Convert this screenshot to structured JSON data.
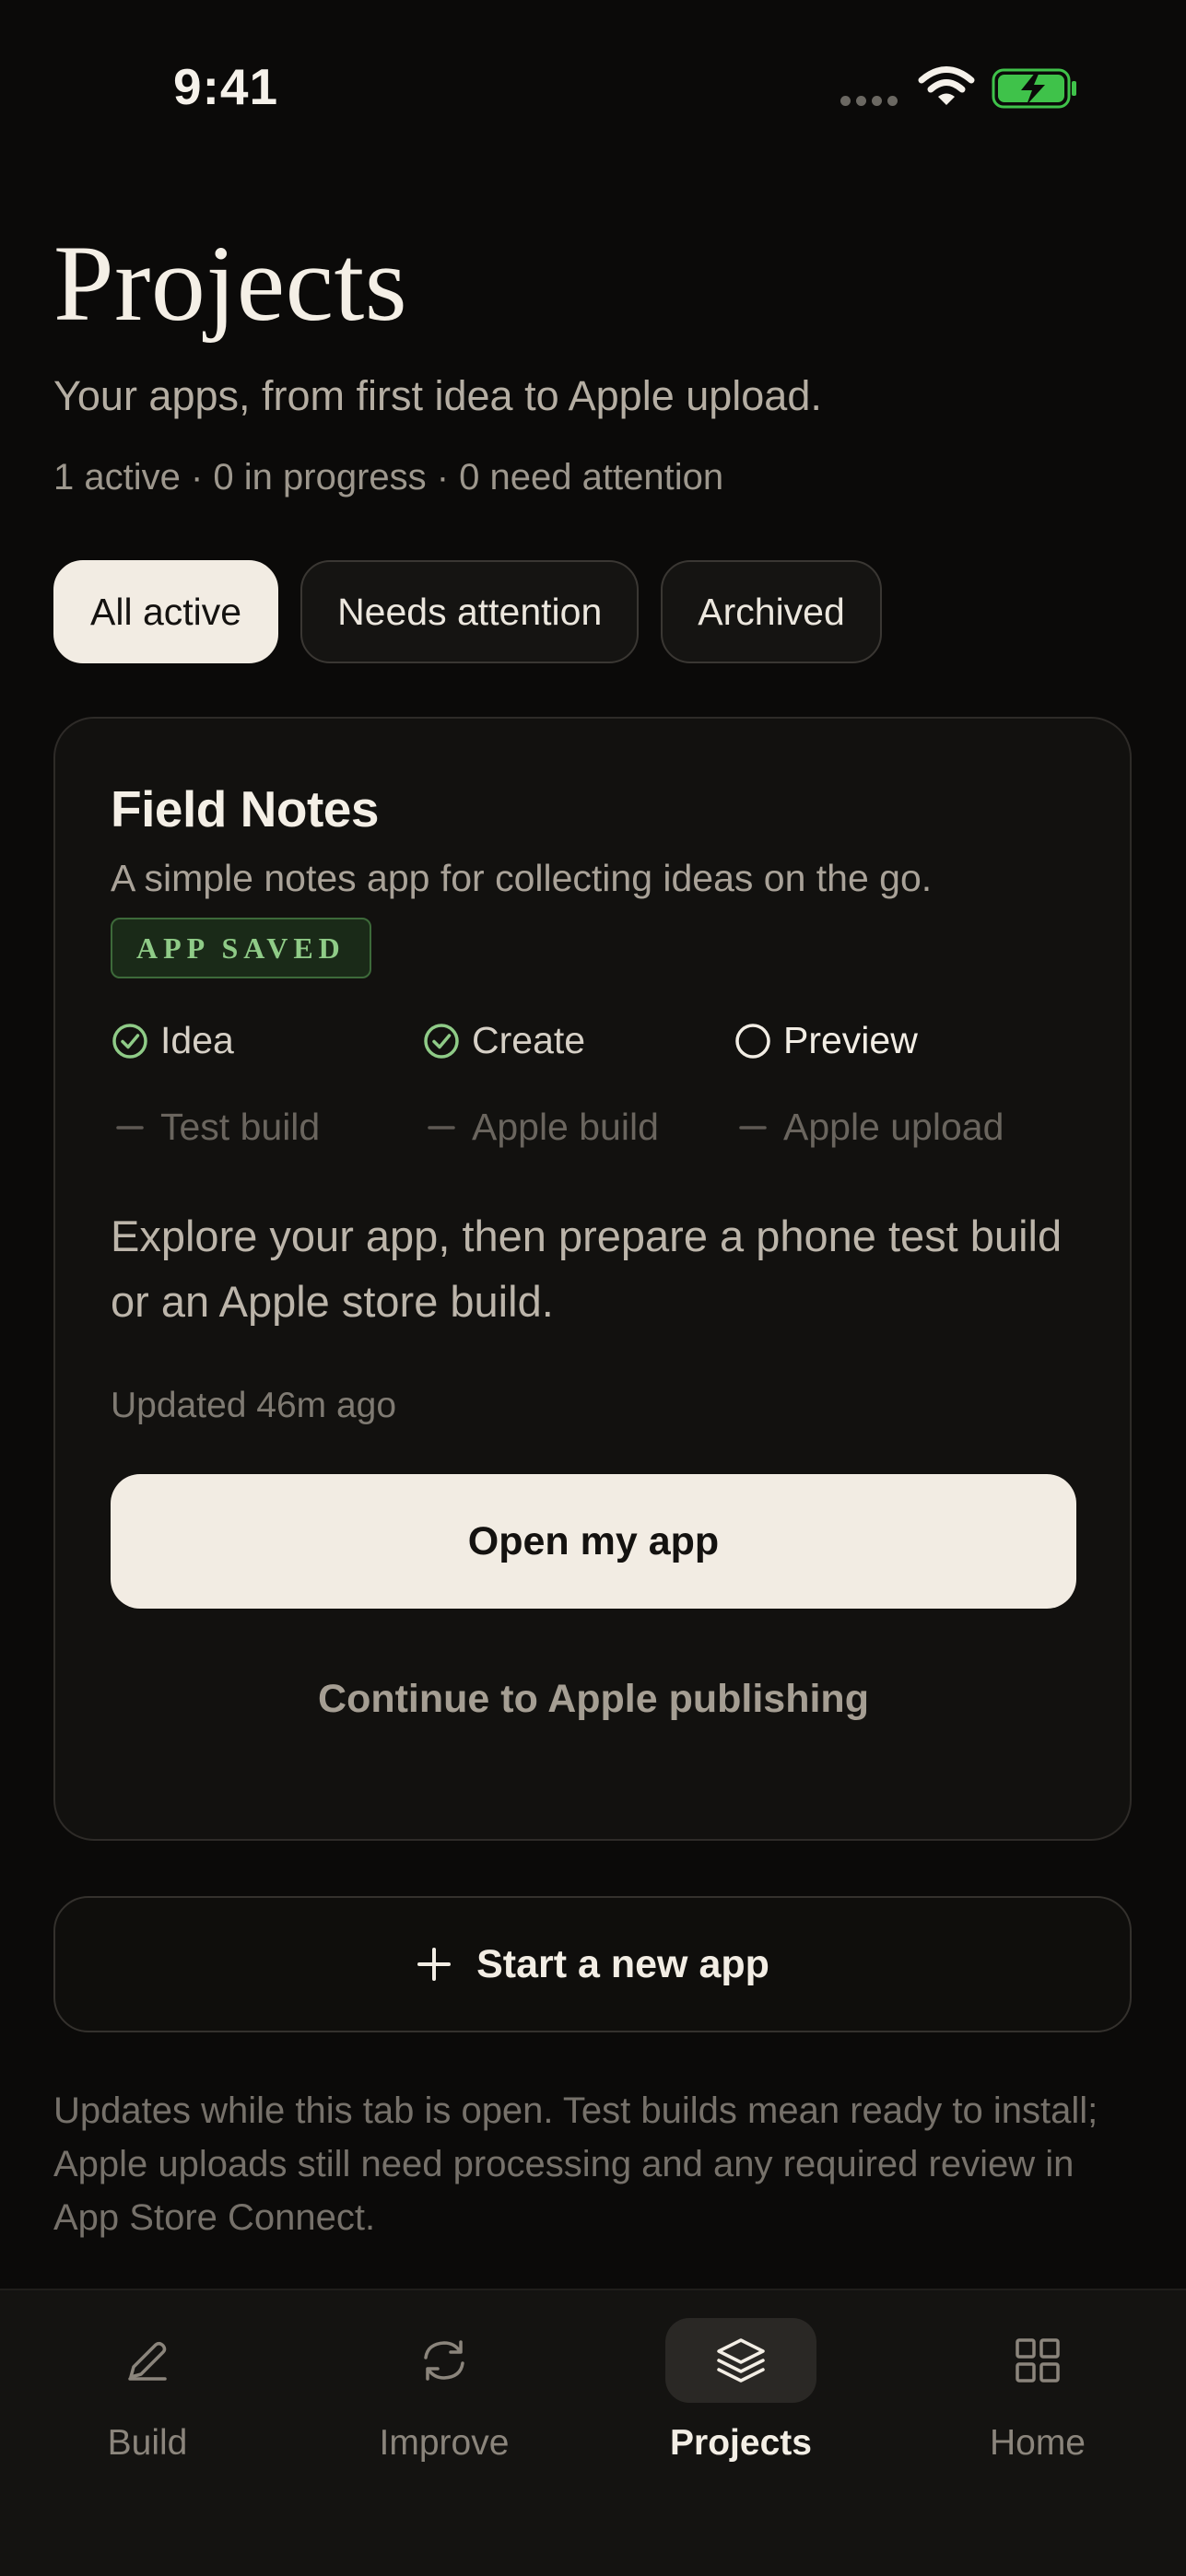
{
  "status_bar": {
    "time": "9:41"
  },
  "header": {
    "title": "Projects",
    "subtitle": "Your apps, from first idea to Apple upload.",
    "counts": "1 active · 0 in progress · 0 need attention"
  },
  "filters": [
    {
      "label": "All active",
      "active": true
    },
    {
      "label": "Needs attention",
      "active": false
    },
    {
      "label": "Archived",
      "active": false
    }
  ],
  "project": {
    "title": "Field Notes",
    "description": "A simple notes app for collecting ideas on the go.",
    "badge": "APP SAVED",
    "steps": [
      {
        "label": "Idea",
        "state": "done"
      },
      {
        "label": "Create",
        "state": "done"
      },
      {
        "label": "Preview",
        "state": "current"
      },
      {
        "label": "Test build",
        "state": "pending"
      },
      {
        "label": "Apple build",
        "state": "pending"
      },
      {
        "label": "Apple upload",
        "state": "pending"
      }
    ],
    "note": "Explore your app, then prepare a phone test build or an Apple store build.",
    "updated": "Updated 46m ago",
    "primary_action": "Open my app",
    "secondary_action": "Continue to Apple publishing"
  },
  "new_app_label": "Start a new app",
  "footnote": "Updates while this tab is open. Test builds mean ready to install; Apple uploads still need processing and any required review in App Store Connect.",
  "tabs": [
    {
      "label": "Build",
      "icon": "pencil-icon",
      "active": false
    },
    {
      "label": "Improve",
      "icon": "refresh-icon",
      "active": false
    },
    {
      "label": "Projects",
      "icon": "layers-icon",
      "active": true
    },
    {
      "label": "Home",
      "icon": "grid-icon",
      "active": false
    }
  ],
  "colors": {
    "background": "#0b0a09",
    "accent_green": "#8fcb87",
    "battery_green": "#3fc24a",
    "chip_active": "#f2ece3"
  }
}
